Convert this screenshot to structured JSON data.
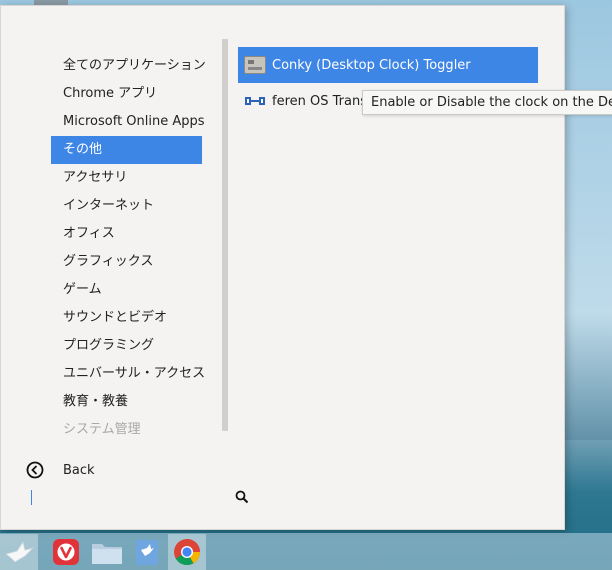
{
  "categories": [
    {
      "label": "全てのアプリケーション",
      "state": "normal"
    },
    {
      "label": "Chrome アプリ",
      "state": "normal"
    },
    {
      "label": "Microsoft Online Apps",
      "state": "normal"
    },
    {
      "label": "その他",
      "state": "selected"
    },
    {
      "label": "アクセサリ",
      "state": "normal"
    },
    {
      "label": "インターネット",
      "state": "normal"
    },
    {
      "label": "オフィス",
      "state": "normal"
    },
    {
      "label": "グラフィックス",
      "state": "normal"
    },
    {
      "label": "ゲーム",
      "state": "normal"
    },
    {
      "label": "サウンドとビデオ",
      "state": "normal"
    },
    {
      "label": "プログラミング",
      "state": "normal"
    },
    {
      "label": "ユニバーサル・アクセス",
      "state": "normal"
    },
    {
      "label": "教育・教養",
      "state": "normal"
    },
    {
      "label": "システム管理",
      "state": "disabled"
    }
  ],
  "apps": [
    {
      "label": "Conky (Desktop Clock) Toggler",
      "icon": "conky-icon",
      "selected": true
    },
    {
      "label": "feren OS Transf",
      "icon": "transfer-icon",
      "selected": false
    }
  ],
  "tooltip": {
    "text": "Enable or Disable the clock on the Deskto"
  },
  "back": {
    "label": "Back",
    "icon": "back-circle-icon"
  },
  "search": {
    "icon": "search-icon",
    "value": ""
  },
  "taskbar": {
    "items": [
      {
        "icon": "dove-menu-icon"
      },
      {
        "icon": "vivaldi-icon"
      },
      {
        "icon": "folder-icon"
      },
      {
        "icon": "store-icon"
      },
      {
        "icon": "chrome-icon"
      }
    ]
  },
  "colors": {
    "accent": "#3d86e6",
    "panel": "#f4f3f1",
    "disabled": "#a9a9a9"
  }
}
